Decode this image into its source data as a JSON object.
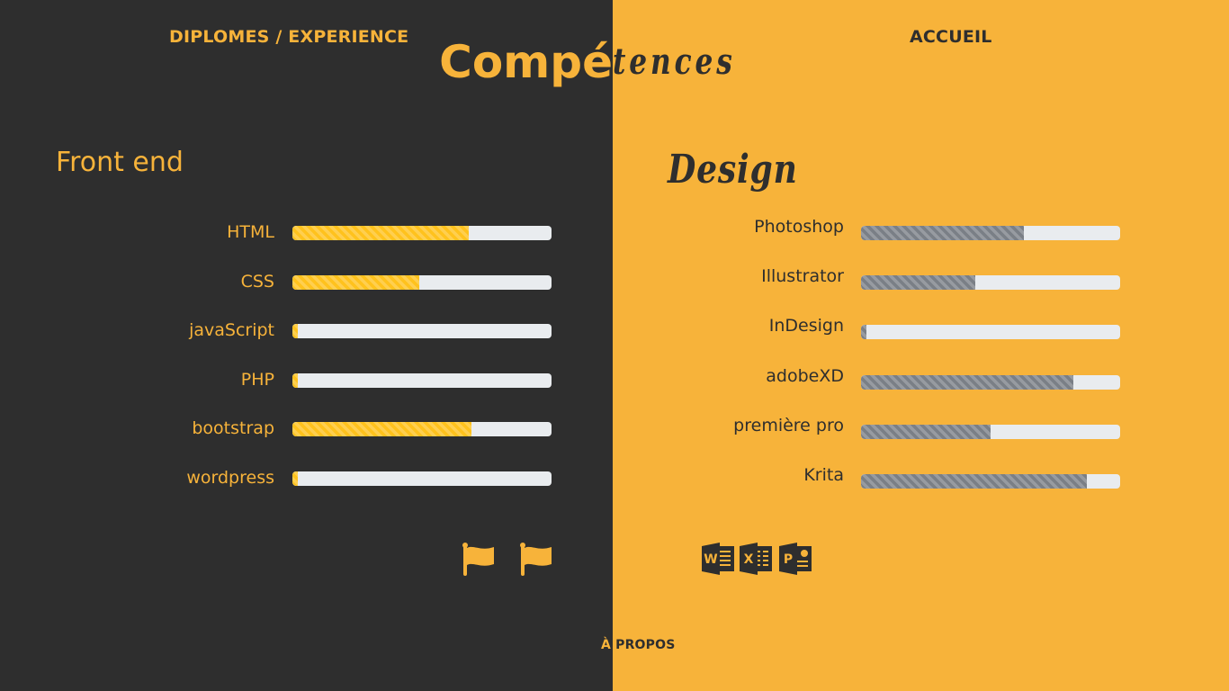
{
  "nav": {
    "diplomes": "DIPLOMES / EXPERIENCE",
    "accueil": "ACCUEIL",
    "apropos_accent": "À",
    "apropos_rest": " PROPOS"
  },
  "title": {
    "left": "Compé",
    "right": "tences"
  },
  "front": {
    "title": "Front end",
    "skills": [
      {
        "label": "HTML",
        "level": 68
      },
      {
        "label": "CSS",
        "level": 49
      },
      {
        "label": "javaScript",
        "level": 2
      },
      {
        "label": "PHP",
        "level": 2
      },
      {
        "label": "bootstrap",
        "level": 69
      },
      {
        "label": "wordpress",
        "level": 2
      }
    ]
  },
  "design": {
    "title": "Design",
    "skills": [
      {
        "label": "Photoshop",
        "level": 63
      },
      {
        "label": "Illustrator",
        "level": 44
      },
      {
        "label": "InDesign",
        "level": 2
      },
      {
        "label": "adobeXD",
        "level": 82
      },
      {
        "label": "première pro",
        "level": 50
      },
      {
        "label": "Krita",
        "level": 87
      }
    ]
  },
  "icons": {
    "flags": [
      "flag-icon",
      "flag-icon"
    ],
    "office": [
      "word-icon",
      "excel-icon",
      "powerpoint-icon"
    ]
  },
  "colors": {
    "dark": "#2e2e2e",
    "accent": "#f7b33a",
    "bar_front": "#ffc21d",
    "bar_design": "#7a7f86",
    "bar_track": "#e9ecef"
  }
}
